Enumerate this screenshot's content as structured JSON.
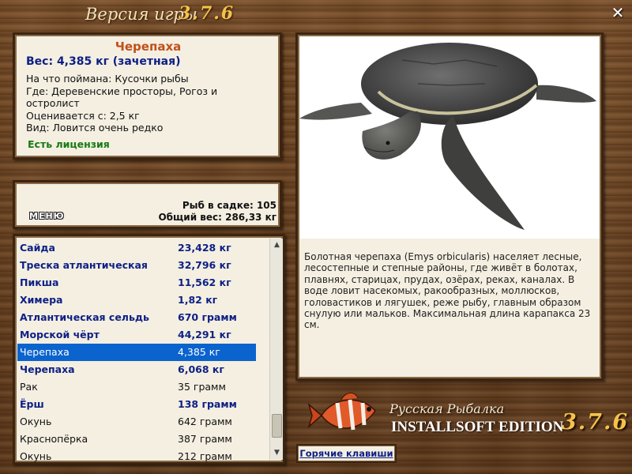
{
  "window": {
    "title": "Версия игры",
    "version": "3.7.6",
    "close_label": "✕"
  },
  "fish_info": {
    "name": "Черепаха",
    "weight": "Вес: 4,385 кг (зачетная)",
    "lines": [
      "На что поймана: Кусочки рыбы",
      "Где: Деревенские просторы, Рогоз и",
      "остролист",
      "Оценивается с: 2,5 кг",
      "Вид: Ловится очень редко"
    ],
    "license": "Есть лицензия"
  },
  "stats": {
    "fish_count": "Рыб в садке: 105",
    "total_weight": "Общий вес: 286,33 кг",
    "menu_label": "МЕНЮ"
  },
  "catch_list": [
    {
      "name": "Сайда",
      "weight": "23,428 кг",
      "style": "rare"
    },
    {
      "name": "Треска атлантическая",
      "weight": "32,796 кг",
      "style": "rare"
    },
    {
      "name": "Пикша",
      "weight": "11,562 кг",
      "style": "rare"
    },
    {
      "name": "Химера",
      "weight": "1,82 кг",
      "style": "rare"
    },
    {
      "name": "Атлантическая сельдь",
      "weight": "670 грамм",
      "style": "rare"
    },
    {
      "name": "Морской чёрт",
      "weight": "44,291 кг",
      "style": "rare"
    },
    {
      "name": "Черепаха",
      "weight": "4,385 кг",
      "style": "selected"
    },
    {
      "name": "Черепаха",
      "weight": "6,068 кг",
      "style": "rare"
    },
    {
      "name": "Рак",
      "weight": "35 грамм",
      "style": "common"
    },
    {
      "name": "Ёрш",
      "weight": "138 грамм",
      "style": "rare"
    },
    {
      "name": "Окунь",
      "weight": "642 грамм",
      "style": "common"
    },
    {
      "name": "Краснопёрка",
      "weight": "387 грамм",
      "style": "common"
    },
    {
      "name": "Окунь",
      "weight": "212 грамм",
      "style": "common"
    }
  ],
  "description": "Болотная черепаха (Emys orbicularis) населяет лесные, лесостепные и степные районы, где живёт в болотах, плавнях, старицах, прудах, озёрах, реках, каналах. В воде ловит насекомых, ракообразных, моллюсков, головастиков и лягушек, реже рыбу, главным образом снулую или мальков. Максимальная длина карапакса 23 см.",
  "logo": {
    "title": "Русская Рыбалка",
    "edition": "INSTALLSOFT EDITION",
    "version": "3.7.6"
  },
  "hotkeys_label": "Горячие клавиши",
  "colors": {
    "rare_text": "#0d1f85",
    "selected_bg": "#0b63ce",
    "fish_name": "#c0501c",
    "license": "#177a12",
    "version_gold": "#f5c34a"
  },
  "icons": {
    "close": "close-icon",
    "scroll_up": "scroll-up-arrow-icon",
    "scroll_down": "scroll-down-arrow-icon"
  }
}
